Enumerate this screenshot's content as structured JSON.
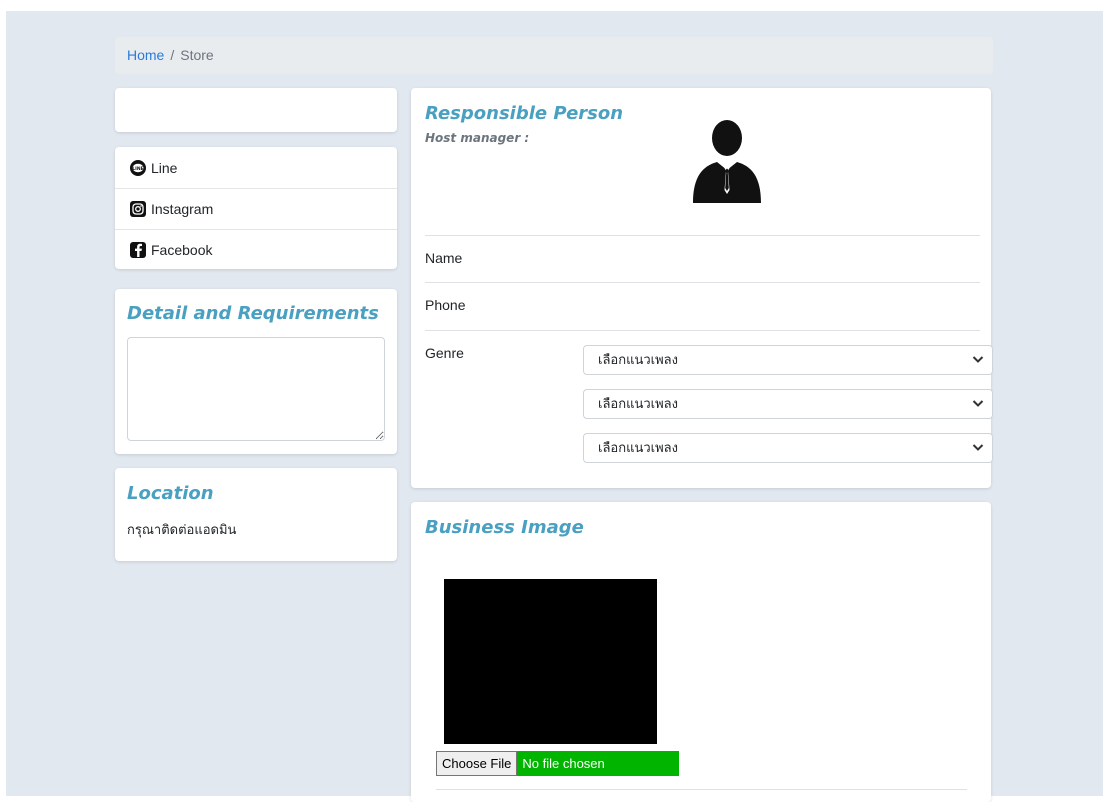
{
  "breadcrumb": {
    "home": "Home",
    "separator": "/",
    "current": "Store"
  },
  "social": {
    "items": [
      {
        "icon": "line-icon",
        "label": "Line"
      },
      {
        "icon": "instagram-icon",
        "label": "Instagram"
      },
      {
        "icon": "facebook-icon",
        "label": "Facebook"
      }
    ]
  },
  "detail": {
    "title": "Detail and Requirements",
    "value": ""
  },
  "location": {
    "title": "Location",
    "text": "กรุณาติดต่อแอดมิน"
  },
  "responsible": {
    "title": "Responsible Person",
    "subtitle": "Host manager :",
    "avatar_icon": "person-in-suit-icon",
    "name_label": "Name",
    "phone_label": "Phone",
    "genre_label": "Genre",
    "genre_selects": [
      "เลือกแนวเพลง",
      "เลือกแนวเพลง",
      "เลือกแนวเพลง"
    ]
  },
  "business_image": {
    "title": "Business Image",
    "choose_file_label": "Choose File",
    "file_status": "No file chosen"
  },
  "colors": {
    "accent": "#4aa0c0",
    "link": "#2a7bd8",
    "background": "#e2e8f0",
    "file_status_bg": "#00b400"
  }
}
